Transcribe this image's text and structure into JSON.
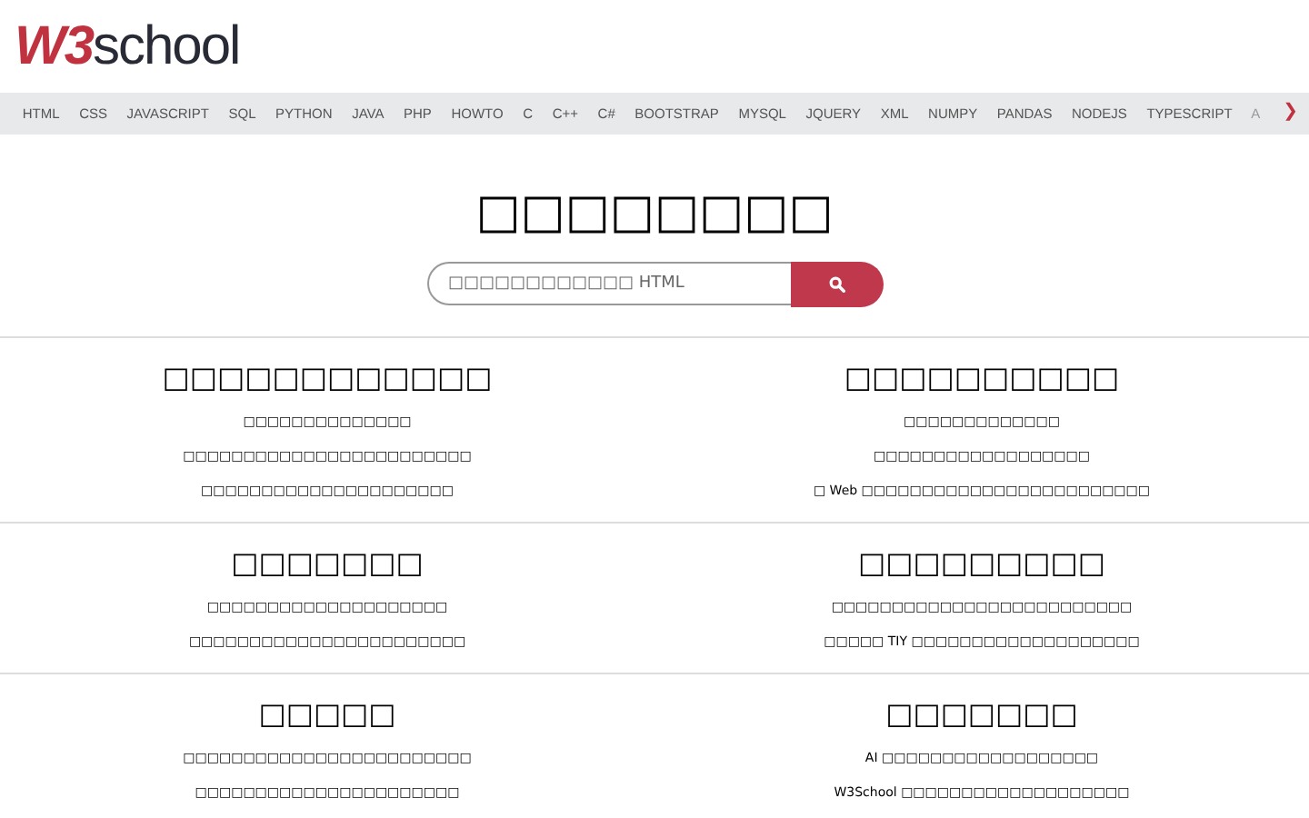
{
  "logo": {
    "mark": "W3",
    "word": "school"
  },
  "nav": {
    "items": [
      "HTML",
      "CSS",
      "JAVASCRIPT",
      "SQL",
      "PYTHON",
      "JAVA",
      "PHP",
      "HOWTO",
      "C",
      "C++",
      "C#",
      "BOOTSTRAP",
      "MYSQL",
      "JQUERY",
      "XML",
      "NUMPY",
      "PANDAS",
      "NODEJS",
      "TYPESCRIPT"
    ],
    "faded_item": "A",
    "next": "❯"
  },
  "hero": {
    "title": "□□□□□□□□",
    "search_placeholder": "□□□□□□□□□□□□ HTML"
  },
  "sections": [
    {
      "left": {
        "heading": "□□□□□□□□□□□□",
        "lines": [
          "□□□□□□□□□□□□□□",
          "□□□□□□□□□□□□□□□□□□□□□□□□",
          "□□□□□□□□□□□□□□□□□□□□□"
        ]
      },
      "right": {
        "heading": "□□□□□□□□□□",
        "lines": [
          "□□□□□□□□□□□□□",
          "□□□□□□□□□□□□□□□□□□",
          "□ Web □□□□□□□□□□□□□□□□□□□□□□□□"
        ]
      }
    },
    {
      "left": {
        "heading": "□□□□□□□",
        "lines": [
          "□□□□□□□□□□□□□□□□□□□□",
          "□□□□□□□□□□□□□□□□□□□□□□□"
        ]
      },
      "right": {
        "heading": "□□□□□□□□□",
        "lines": [
          "□□□□□□□□□□□□□□□□□□□□□□□□□",
          "□□□□□ TIY □□□□□□□□□□□□□□□□□□□"
        ]
      }
    },
    {
      "left": {
        "heading": "□□□□□",
        "lines": [
          "□□□□□□□□□□□□□□□□□□□□□□□□",
          "□□□□□□□□□□□□□□□□□□□□□□"
        ]
      },
      "right": {
        "heading": "□□□□□□□",
        "lines": [
          "AI □□□□□□□□□□□□□□□□□□",
          "W3School □□□□□□□□□□□□□□□□□□□"
        ]
      }
    }
  ]
}
